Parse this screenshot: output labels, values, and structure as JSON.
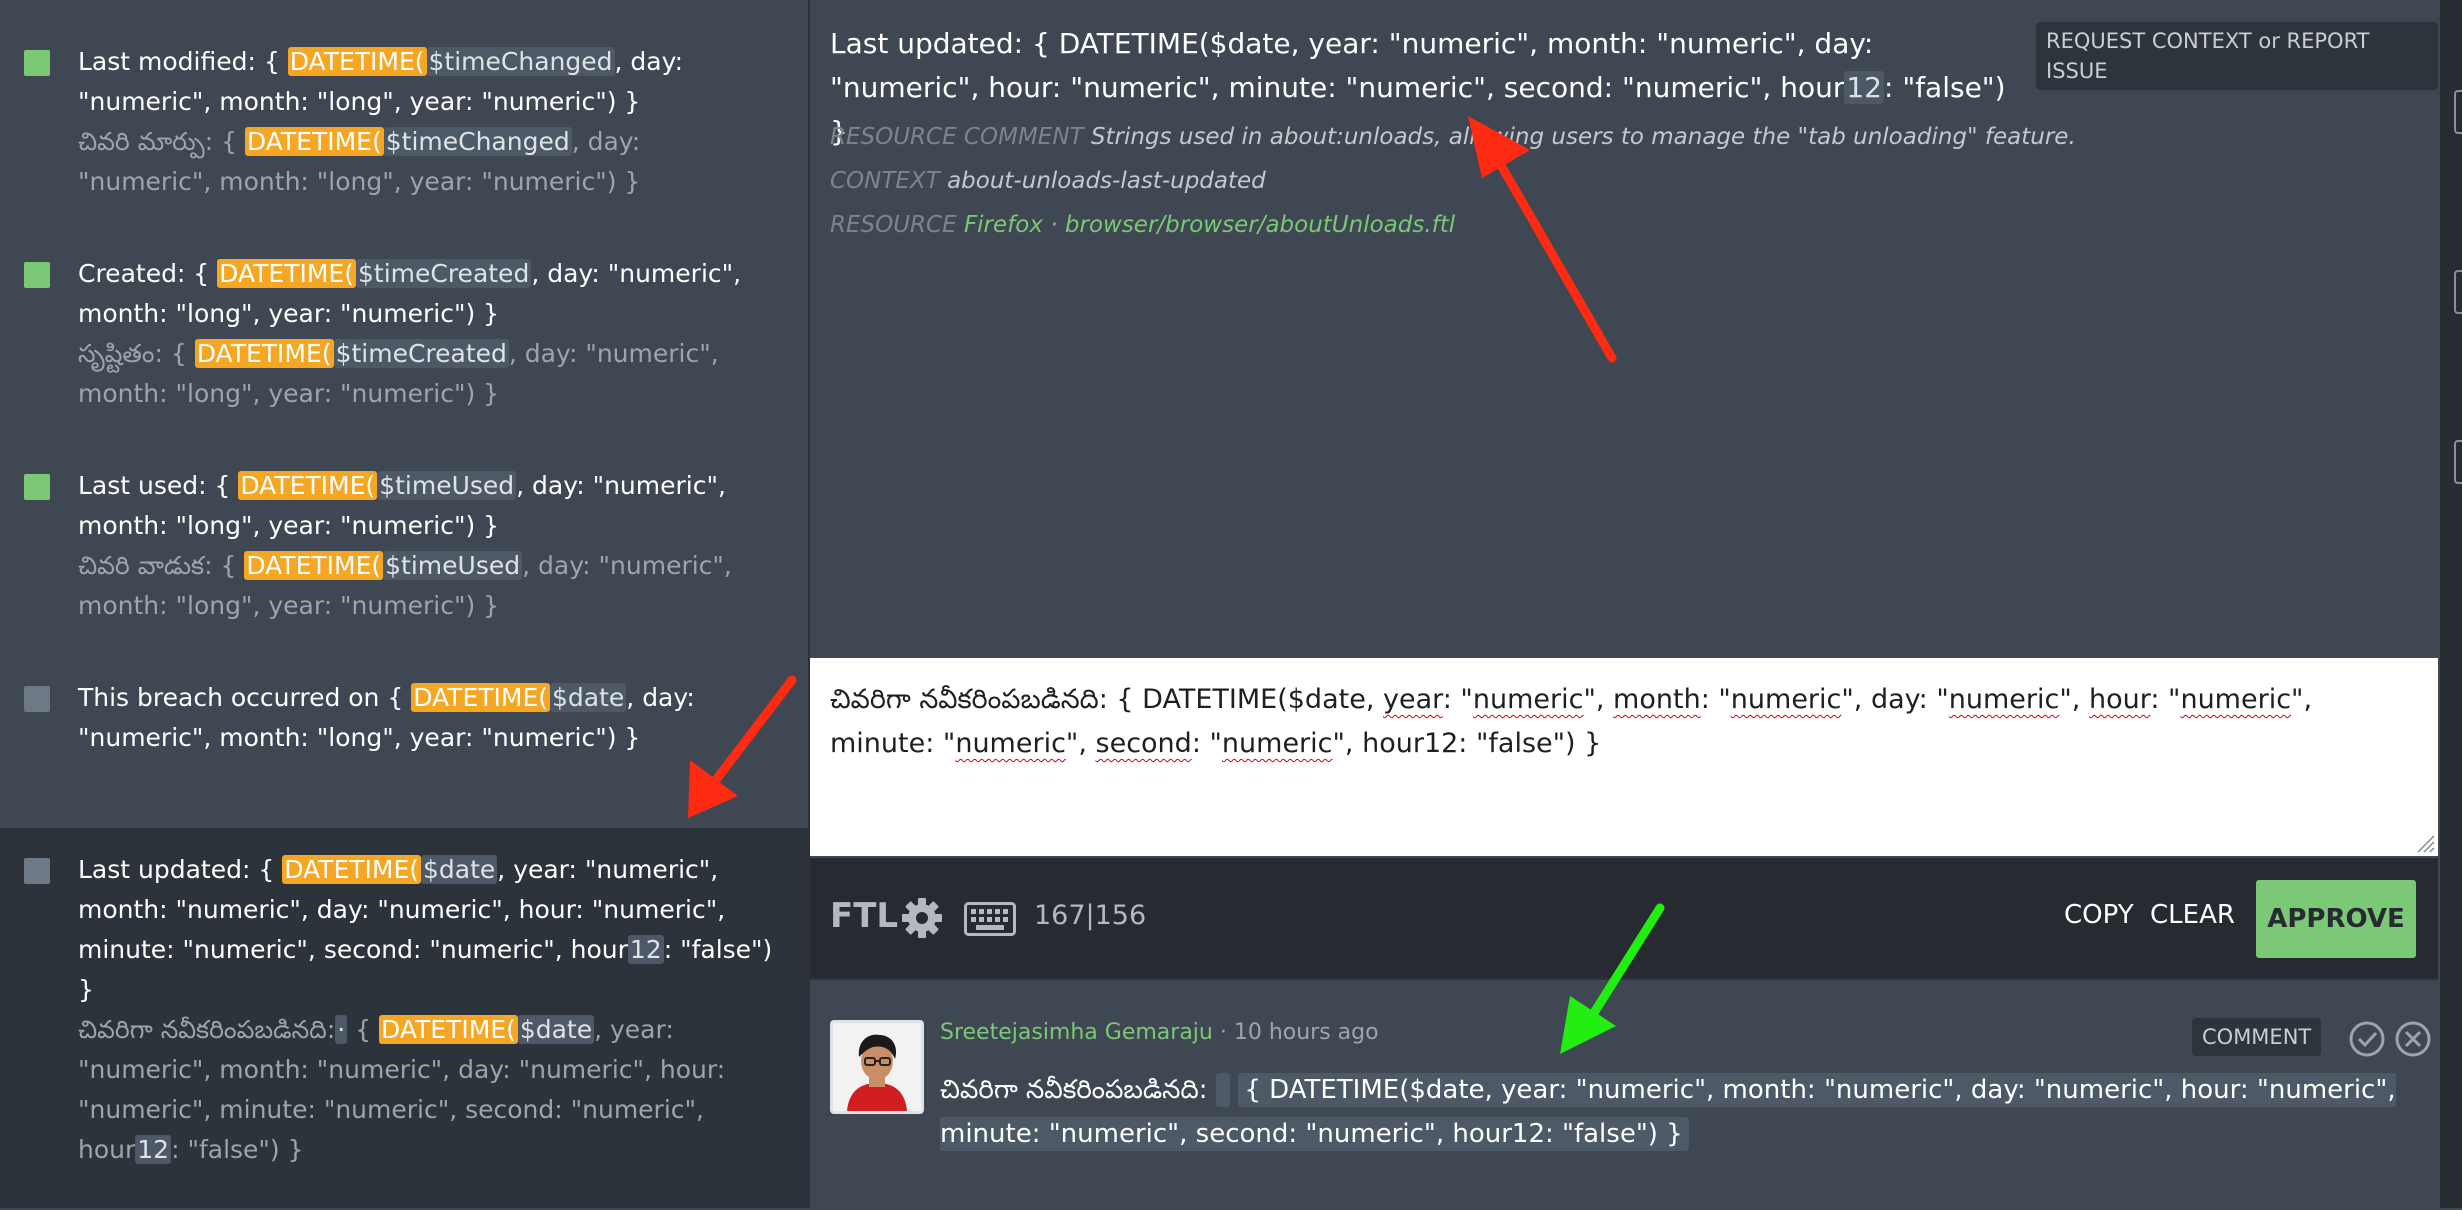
{
  "entries": [
    {
      "status": "translated",
      "source": {
        "pre": "Last modified: { ",
        "fn": "DATETIME(",
        "var": "$timeChanged",
        "post": ", day: \"numeric\", month: \"long\", year: \"numeric\") }"
      },
      "translation": {
        "pre": "చివరి మార్పు: { ",
        "fn": "DATETIME(",
        "var": "$timeChanged",
        "post": ", day: \"numeric\", month: \"long\", year: \"numeric\") }"
      }
    },
    {
      "status": "translated",
      "source": {
        "pre": "Created: { ",
        "fn": "DATETIME(",
        "var": "$timeCreated",
        "post": ", day: \"numeric\", month: \"long\", year: \"numeric\") }"
      },
      "translation": {
        "pre": "సృష్టితం: { ",
        "fn": "DATETIME(",
        "var": "$timeCreated",
        "post": ", day: \"numeric\", month: \"long\", year: \"numeric\") }"
      }
    },
    {
      "status": "translated",
      "source": {
        "pre": "Last used: { ",
        "fn": "DATETIME(",
        "var": "$timeUsed",
        "post": ", day: \"numeric\", month: \"long\", year: \"numeric\") }"
      },
      "translation": {
        "pre": "చివరి వాడుక: { ",
        "fn": "DATETIME(",
        "var": "$timeUsed",
        "post": ", day: \"numeric\", month: \"long\", year: \"numeric\") }"
      }
    },
    {
      "status": "missing",
      "source": {
        "pre": "This breach occurred on { ",
        "fn": "DATETIME(",
        "var": "$date",
        "post": ", day: \"numeric\", month: \"long\", year: \"numeric\") }"
      }
    },
    {
      "status": "missing",
      "source": {
        "pre": "Last updated: { ",
        "fn": "DATETIME(",
        "var": "$date",
        "mid": ", year: \"numeric\", month: \"numeric\", day: \"numeric\", hour: \"numeric\", minute: \"numeric\", second: \"numeric\", hour",
        "ph": "12",
        "post": ": \"false\") }"
      },
      "translation": {
        "pre": "చివరిగా నవీకరింపబడినది:",
        "space": "·",
        "open": " { ",
        "fn": "DATETIME(",
        "var": "$date",
        "mid": ", year: \"numeric\", month: \"numeric\", day: \"numeric\", hour: \"numeric\", minute: \"numeric\", second: \"numeric\", hour",
        "ph": "12",
        "post": ": \"false\") }"
      }
    }
  ],
  "original": {
    "pre": "Last updated: { DATETIME($date, year: \"numeric\", month: \"numeric\", day: \"numeric\", hour: \"numeric\", minute: \"numeric\", second: \"numeric\", hour",
    "ph": "12",
    "post": ": \"false\") }"
  },
  "request_button": "REQUEST CONTEXT or REPORT ISSUE",
  "meta": {
    "resource_comment_label": "RESOURCE COMMENT",
    "resource_comment": "Strings used in about:unloads, allowing users to manage the \"tab unloading\" feature.",
    "context_label": "CONTEXT",
    "context": "about-unloads-last-updated",
    "resource_label": "RESOURCE",
    "project": "Firefox",
    "separator": "·",
    "path": "browser/browser/aboutUnloads.ftl"
  },
  "editor": {
    "prefix": "చివరిగా నవీకరింపబడినది:  { DATETIME($date, ",
    "w_year": "year",
    "t1": ": \"",
    "w_numeric1": "numeric",
    "t2": "\", ",
    "w_month": "month",
    "t3": ": \"",
    "w_numeric2": "numeric",
    "t4": "\", day: \"",
    "w_numeric3": "numeric",
    "t5": "\", ",
    "w_hour": "hour",
    "t6": ": \"",
    "w_numeric4": "numeric",
    "t7": "\", minute: \"",
    "w_numeric5": "numeric",
    "t8": "\", ",
    "w_second": "second",
    "t9": ": \"",
    "w_numeric6": "numeric",
    "t10": "\", hour12: \"false\") }"
  },
  "toolbar": {
    "ftl_label": "FTL",
    "char_count": "167|156",
    "copy": "COPY",
    "clear": "CLEAR",
    "approve": "APPROVE"
  },
  "history": {
    "author": "Sreetejasimha Gemaraju",
    "time_ago": " · 10 hours ago",
    "comment_button": "COMMENT",
    "text_pre": "చివరిగా నవీకరింపబడినది:",
    "text_hl": "{ DATETIME($date, year: \"numeric\", month: \"numeric\", day: \"numeric\", hour: \"numeric\", minute: \"numeric\", second: \"numeric\", hour12: \"false\") }"
  },
  "colors": {
    "translated": "#7bc876",
    "missing": "#6d7985",
    "function_highlight": "#f5a623",
    "variable_highlight": "#4d5967",
    "approve": "#7bc876",
    "arrow_red": "#ff2a12",
    "arrow_green": "#22ee11"
  }
}
